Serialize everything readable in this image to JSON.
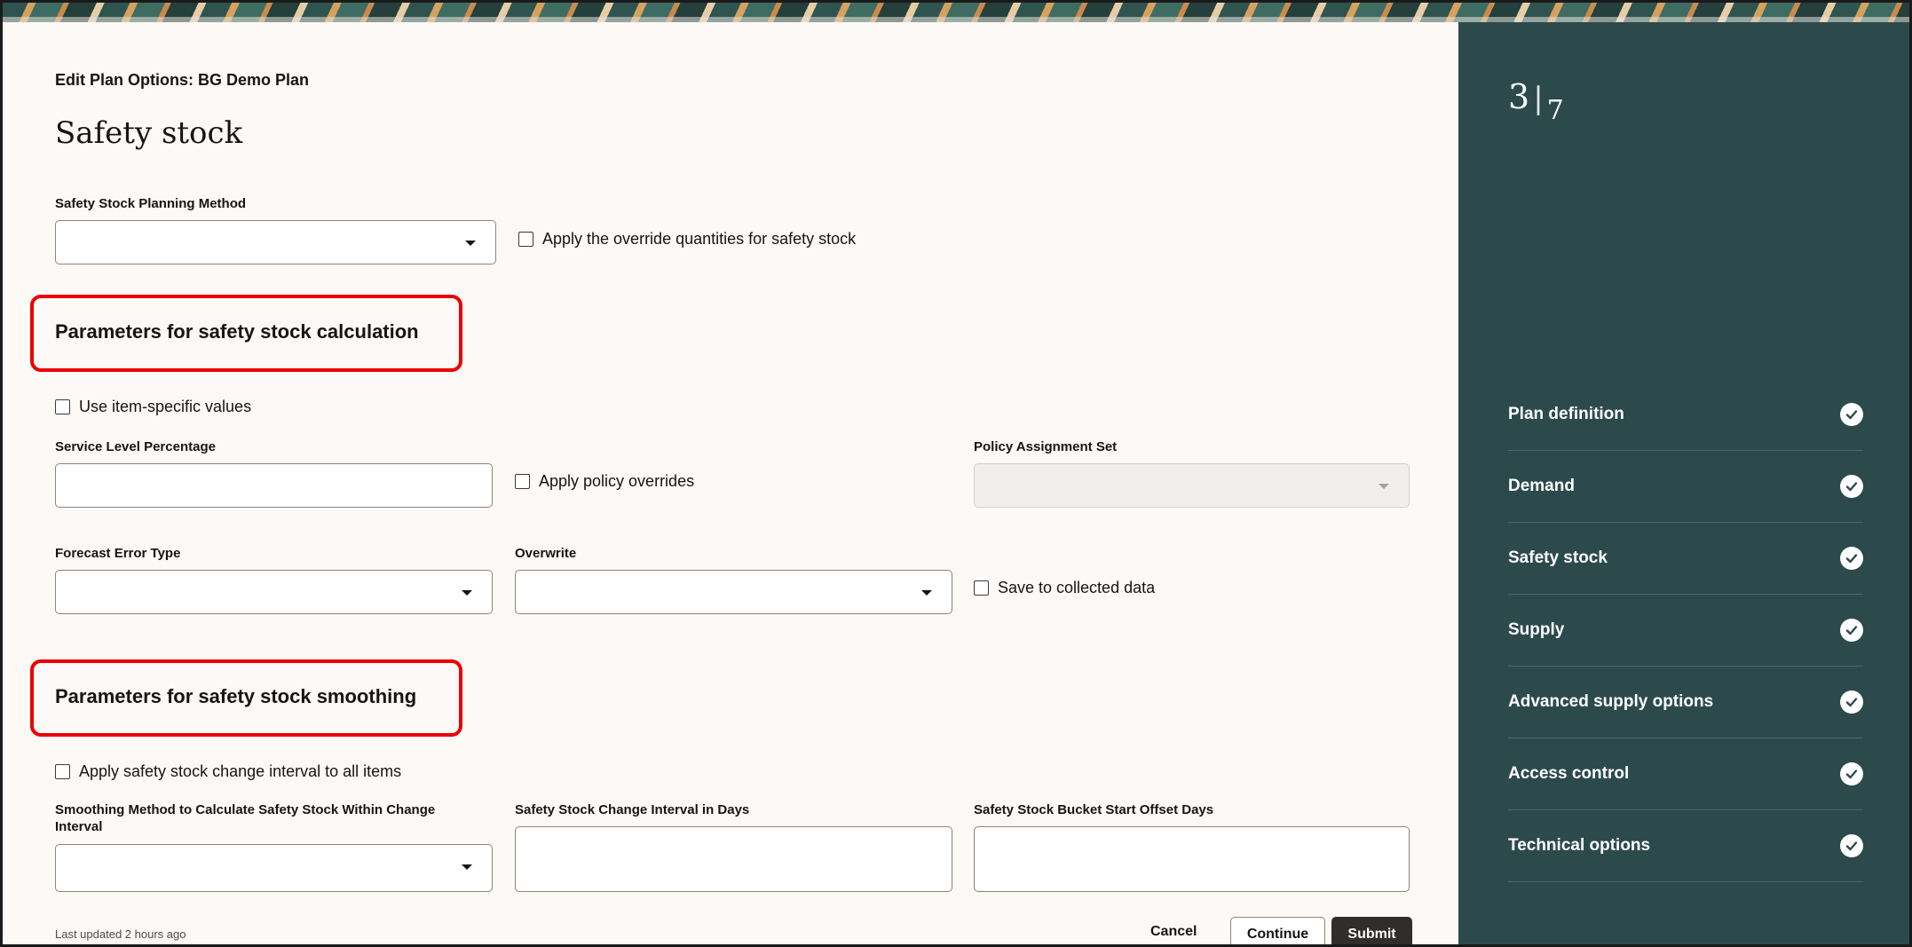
{
  "page": {
    "breadcrumb": "Edit Plan Options: BG Demo Plan",
    "title": "Safety stock"
  },
  "form": {
    "planning_method_label": "Safety Stock Planning Method",
    "planning_method_value": "",
    "apply_override_label": "Apply the override quantities for safety stock",
    "calc_section_title": "Parameters for safety stock calculation",
    "use_item_specific_label": "Use item-specific values",
    "service_level_label": "Service Level Percentage",
    "service_level_value": "",
    "apply_policy_overrides_label": "Apply policy overrides",
    "policy_assignment_set_label": "Policy Assignment Set",
    "policy_assignment_set_value": "",
    "forecast_error_type_label": "Forecast Error Type",
    "forecast_error_type_value": "",
    "overwrite_label": "Overwrite",
    "overwrite_value": "",
    "save_collected_label": "Save to collected data",
    "smoothing_section_title": "Parameters for safety stock smoothing",
    "apply_change_interval_label": "Apply safety stock change interval to all items",
    "smoothing_method_label": "Smoothing Method to Calculate Safety Stock Within Change Interval",
    "smoothing_method_value": "",
    "change_interval_label": "Safety Stock Change Interval in Days",
    "change_interval_value": "",
    "bucket_offset_label": "Safety Stock Bucket Start Offset Days",
    "bucket_offset_value": ""
  },
  "footer": {
    "last_updated": "Last updated 2 hours ago",
    "cancel_label": "Cancel",
    "continue_label": "Continue",
    "submit_label": "Submit"
  },
  "rail": {
    "current_step": "3",
    "total_steps": "7",
    "separator": "|",
    "active_step": "Safety stock",
    "steps": [
      {
        "label": "Plan definition",
        "status": "complete"
      },
      {
        "label": "Demand",
        "status": "complete"
      },
      {
        "label": "Safety stock",
        "status": "complete"
      },
      {
        "label": "Supply",
        "status": "complete"
      },
      {
        "label": "Advanced supply options",
        "status": "complete"
      },
      {
        "label": "Access control",
        "status": "complete"
      },
      {
        "label": "Technical options",
        "status": "complete"
      }
    ]
  },
  "colors": {
    "rail_background": "#2c4a4b",
    "page_background": "#fcf9f7",
    "highlight_border": "#ea0000",
    "submit_background": "#312d2a"
  },
  "icons": {
    "dropdown": "chevron-down-icon",
    "step_status": "check-circle-icon"
  }
}
